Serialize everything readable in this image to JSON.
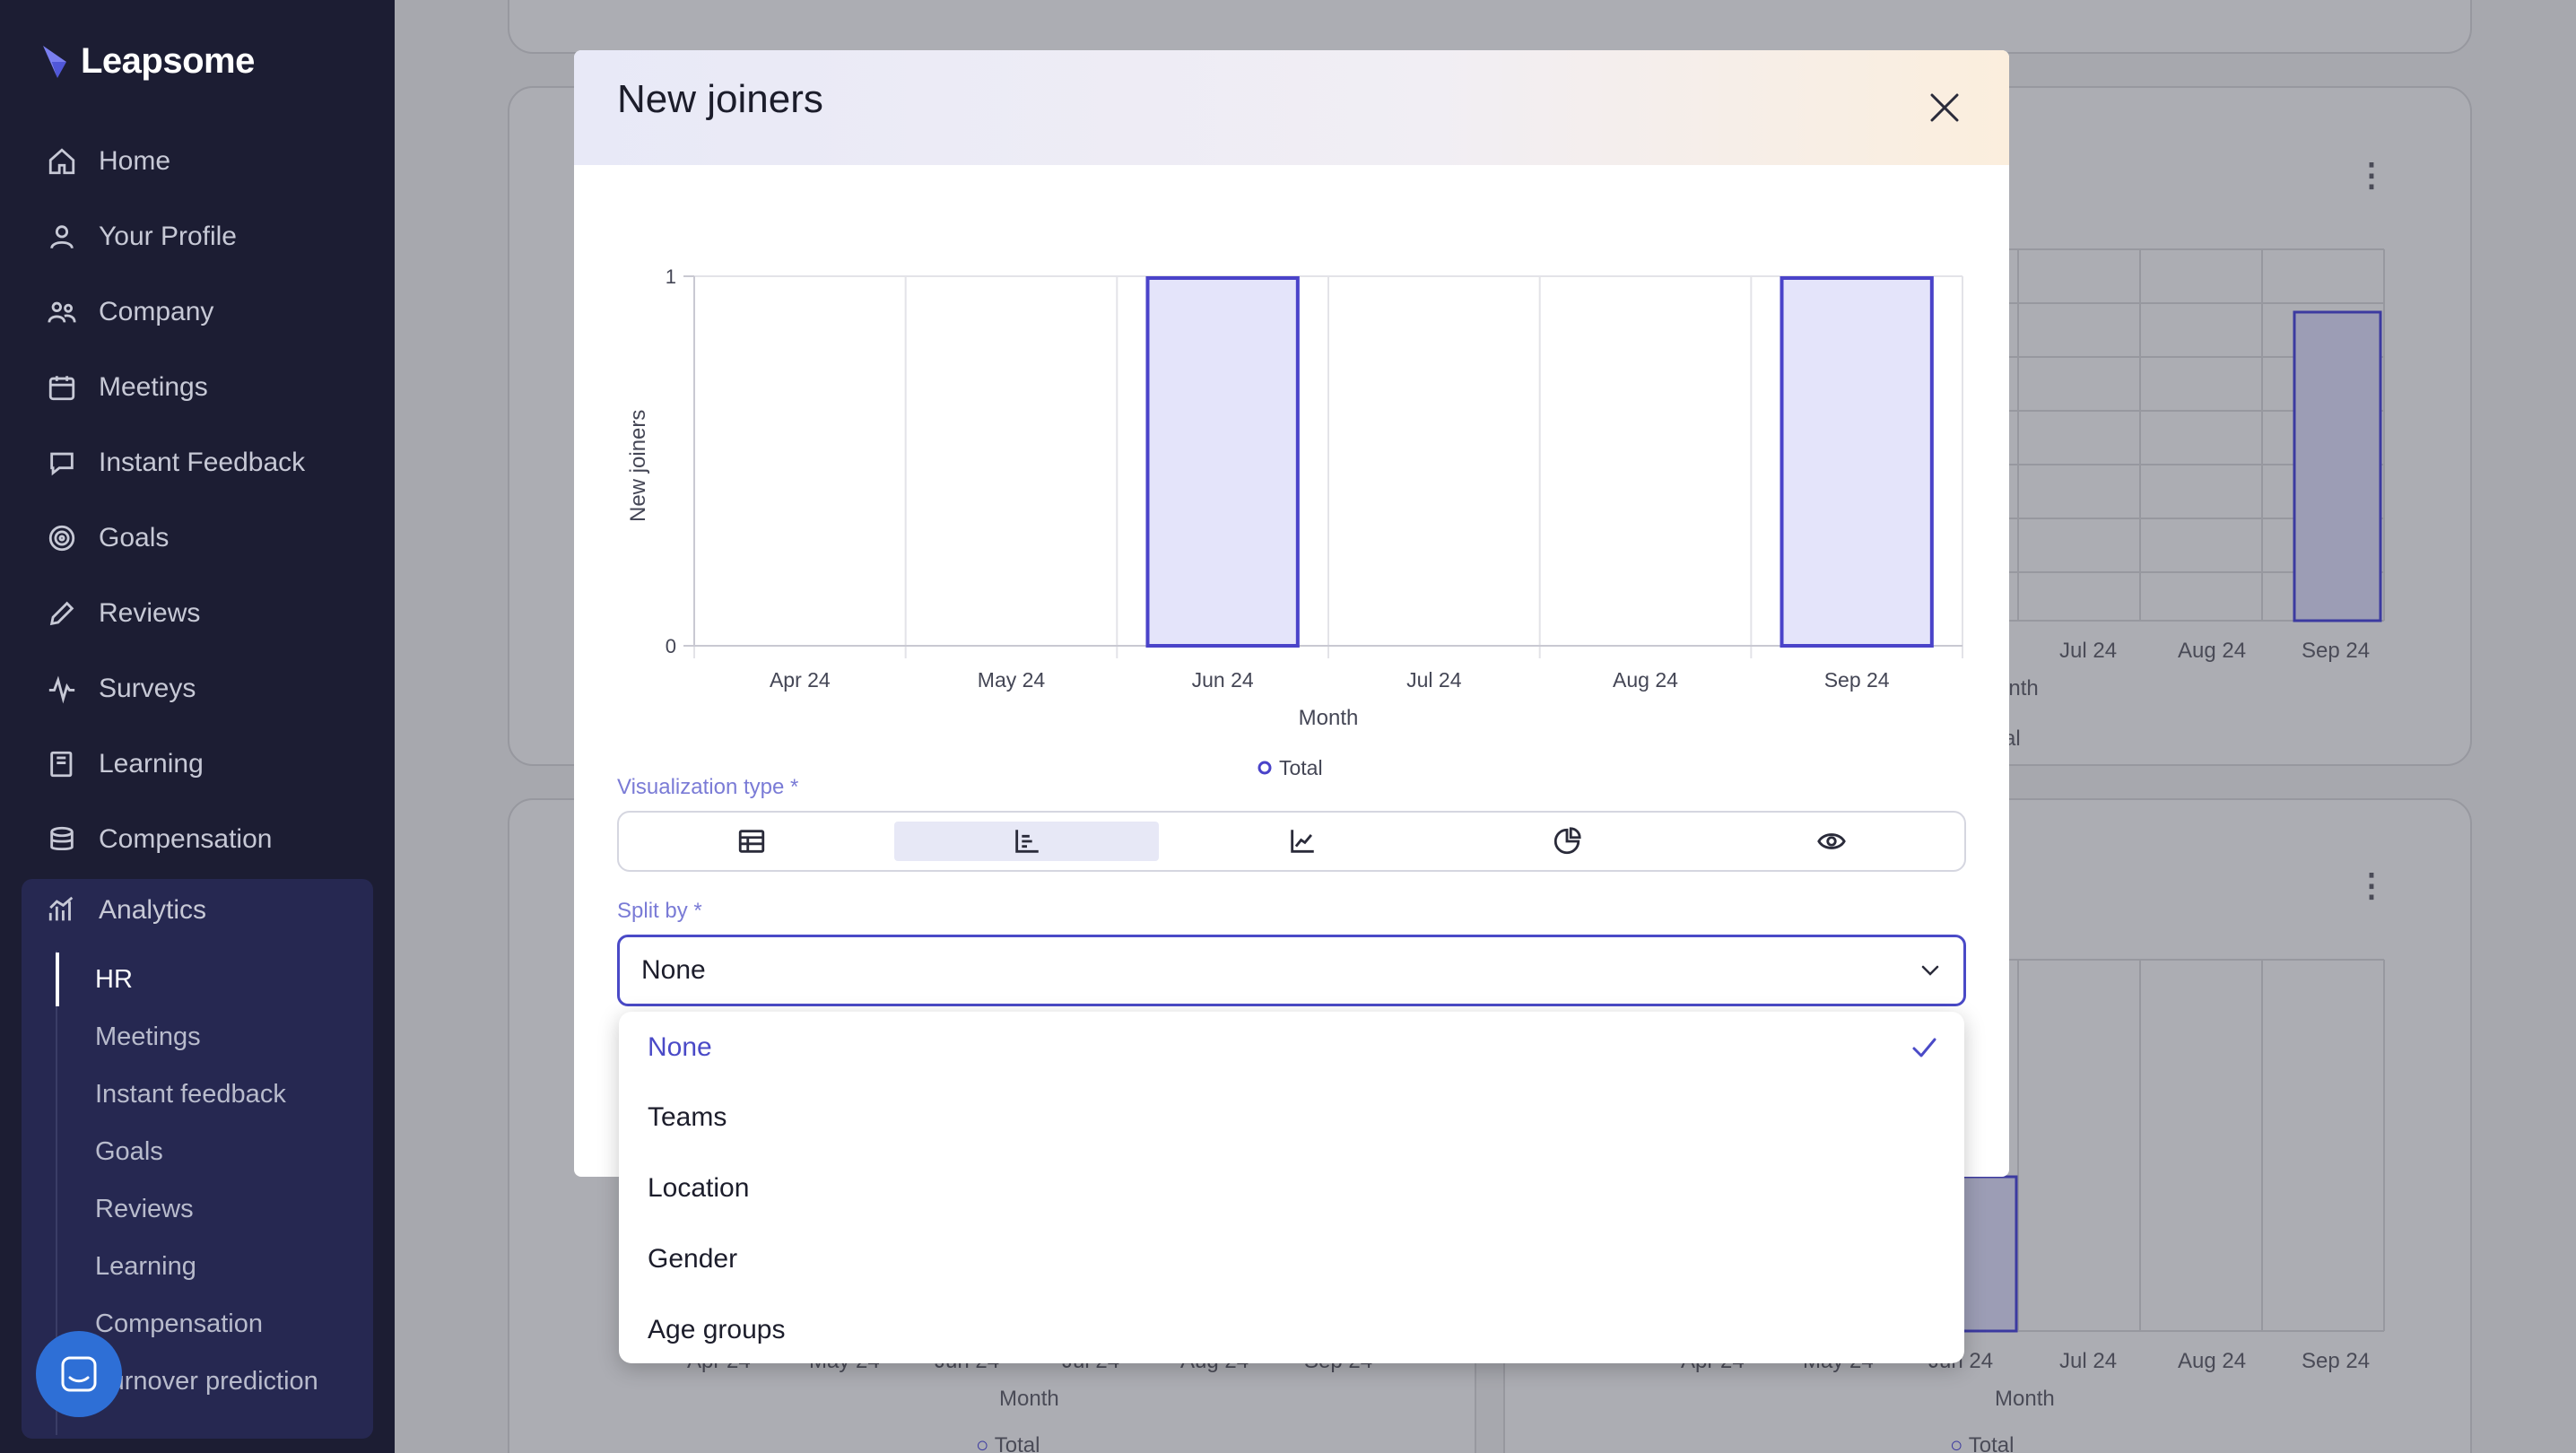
{
  "app": {
    "name": "Leapsome"
  },
  "sidebar": {
    "items": [
      {
        "label": "Home",
        "icon": "home-icon"
      },
      {
        "label": "Your Profile",
        "icon": "user-icon"
      },
      {
        "label": "Company",
        "icon": "people-icon"
      },
      {
        "label": "Meetings",
        "icon": "calendar-icon"
      },
      {
        "label": "Instant Feedback",
        "icon": "chat-icon"
      },
      {
        "label": "Goals",
        "icon": "target-icon"
      },
      {
        "label": "Reviews",
        "icon": "pencil-icon"
      },
      {
        "label": "Surveys",
        "icon": "pulse-icon"
      },
      {
        "label": "Learning",
        "icon": "book-icon"
      },
      {
        "label": "Compensation",
        "icon": "coins-icon"
      }
    ],
    "analytics": {
      "label": "Analytics",
      "subitems": [
        "HR",
        "Meetings",
        "Instant feedback",
        "Goals",
        "Reviews",
        "Learning",
        "Compensation",
        "Turnover prediction"
      ],
      "active": "HR"
    }
  },
  "background": {
    "months_top": [
      "Jul 24",
      "Aug 24",
      "Sep 24"
    ],
    "month_label_top": "onth",
    "total_top": "al",
    "months_left": [
      "Apr 24",
      "May 24",
      "Jun 24",
      "Jul 24",
      "Aug 24",
      "Sep 24"
    ],
    "months_right": [
      "Apr 24",
      "May 24",
      "Jun 24",
      "Jul 24",
      "Aug 24",
      "Sep 24"
    ],
    "month_label": "Month",
    "total_label": "Total"
  },
  "modal": {
    "title": "New joiners",
    "visualization_label": "Visualization type *",
    "visualization_options": [
      "table-icon",
      "bar-chart-icon",
      "line-chart-icon",
      "pie-chart-icon",
      "eye-icon"
    ],
    "visualization_selected": "bar-chart-icon",
    "split_label": "Split by *",
    "split_value": "None"
  },
  "dropdown": {
    "options": [
      "None",
      "Teams",
      "Location",
      "Gender",
      "Age groups"
    ],
    "selected": "None"
  },
  "chart_data": {
    "type": "bar",
    "categories": [
      "Apr 24",
      "May 24",
      "Jun 24",
      "Jul 24",
      "Aug 24",
      "Sep 24"
    ],
    "series": [
      {
        "name": "Total",
        "values": [
          0,
          0,
          1,
          0,
          0,
          1
        ]
      }
    ],
    "xlabel": "Month",
    "ylabel": "New joiners",
    "ylim": [
      0,
      1
    ],
    "yticks": [
      0,
      1
    ],
    "grid": true,
    "legend": "bottom",
    "colors": {
      "bar_fill": "#e4e4fa",
      "bar_stroke": "#4a43c9"
    }
  }
}
